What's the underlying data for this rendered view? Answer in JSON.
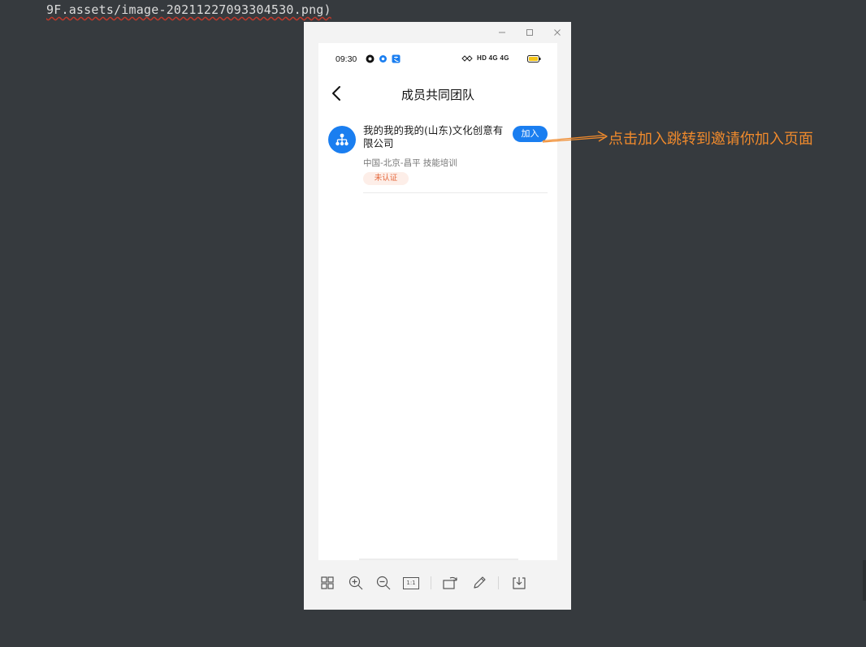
{
  "editor": {
    "image_link": "9F.assets/image-20211227093304530.png)"
  },
  "viewer": {
    "window_controls": {
      "minimize": "—",
      "maximize": "▢",
      "close": "✕"
    },
    "toolbar": {
      "zoom_reset_label": "1:1"
    }
  },
  "phone": {
    "status_bar": {
      "time": "09:30",
      "network": "HD 4G 4G"
    },
    "nav": {
      "title": "成员共同团队"
    },
    "team": {
      "name": "我的我的我的(山东)文化创意有限公司",
      "location_industry": "中国-北京-昌平 技能培训",
      "status_badge": "未认证",
      "join_label": "加入"
    }
  },
  "annotation": {
    "text": "点击加入跳转到邀请你加入页面",
    "color": "#f08a2c"
  },
  "colors": {
    "accent": "#1a7ef0",
    "badge_text": "#e5683c",
    "badge_bg": "#fdeee8",
    "desktop_bg": "#363a3e"
  }
}
